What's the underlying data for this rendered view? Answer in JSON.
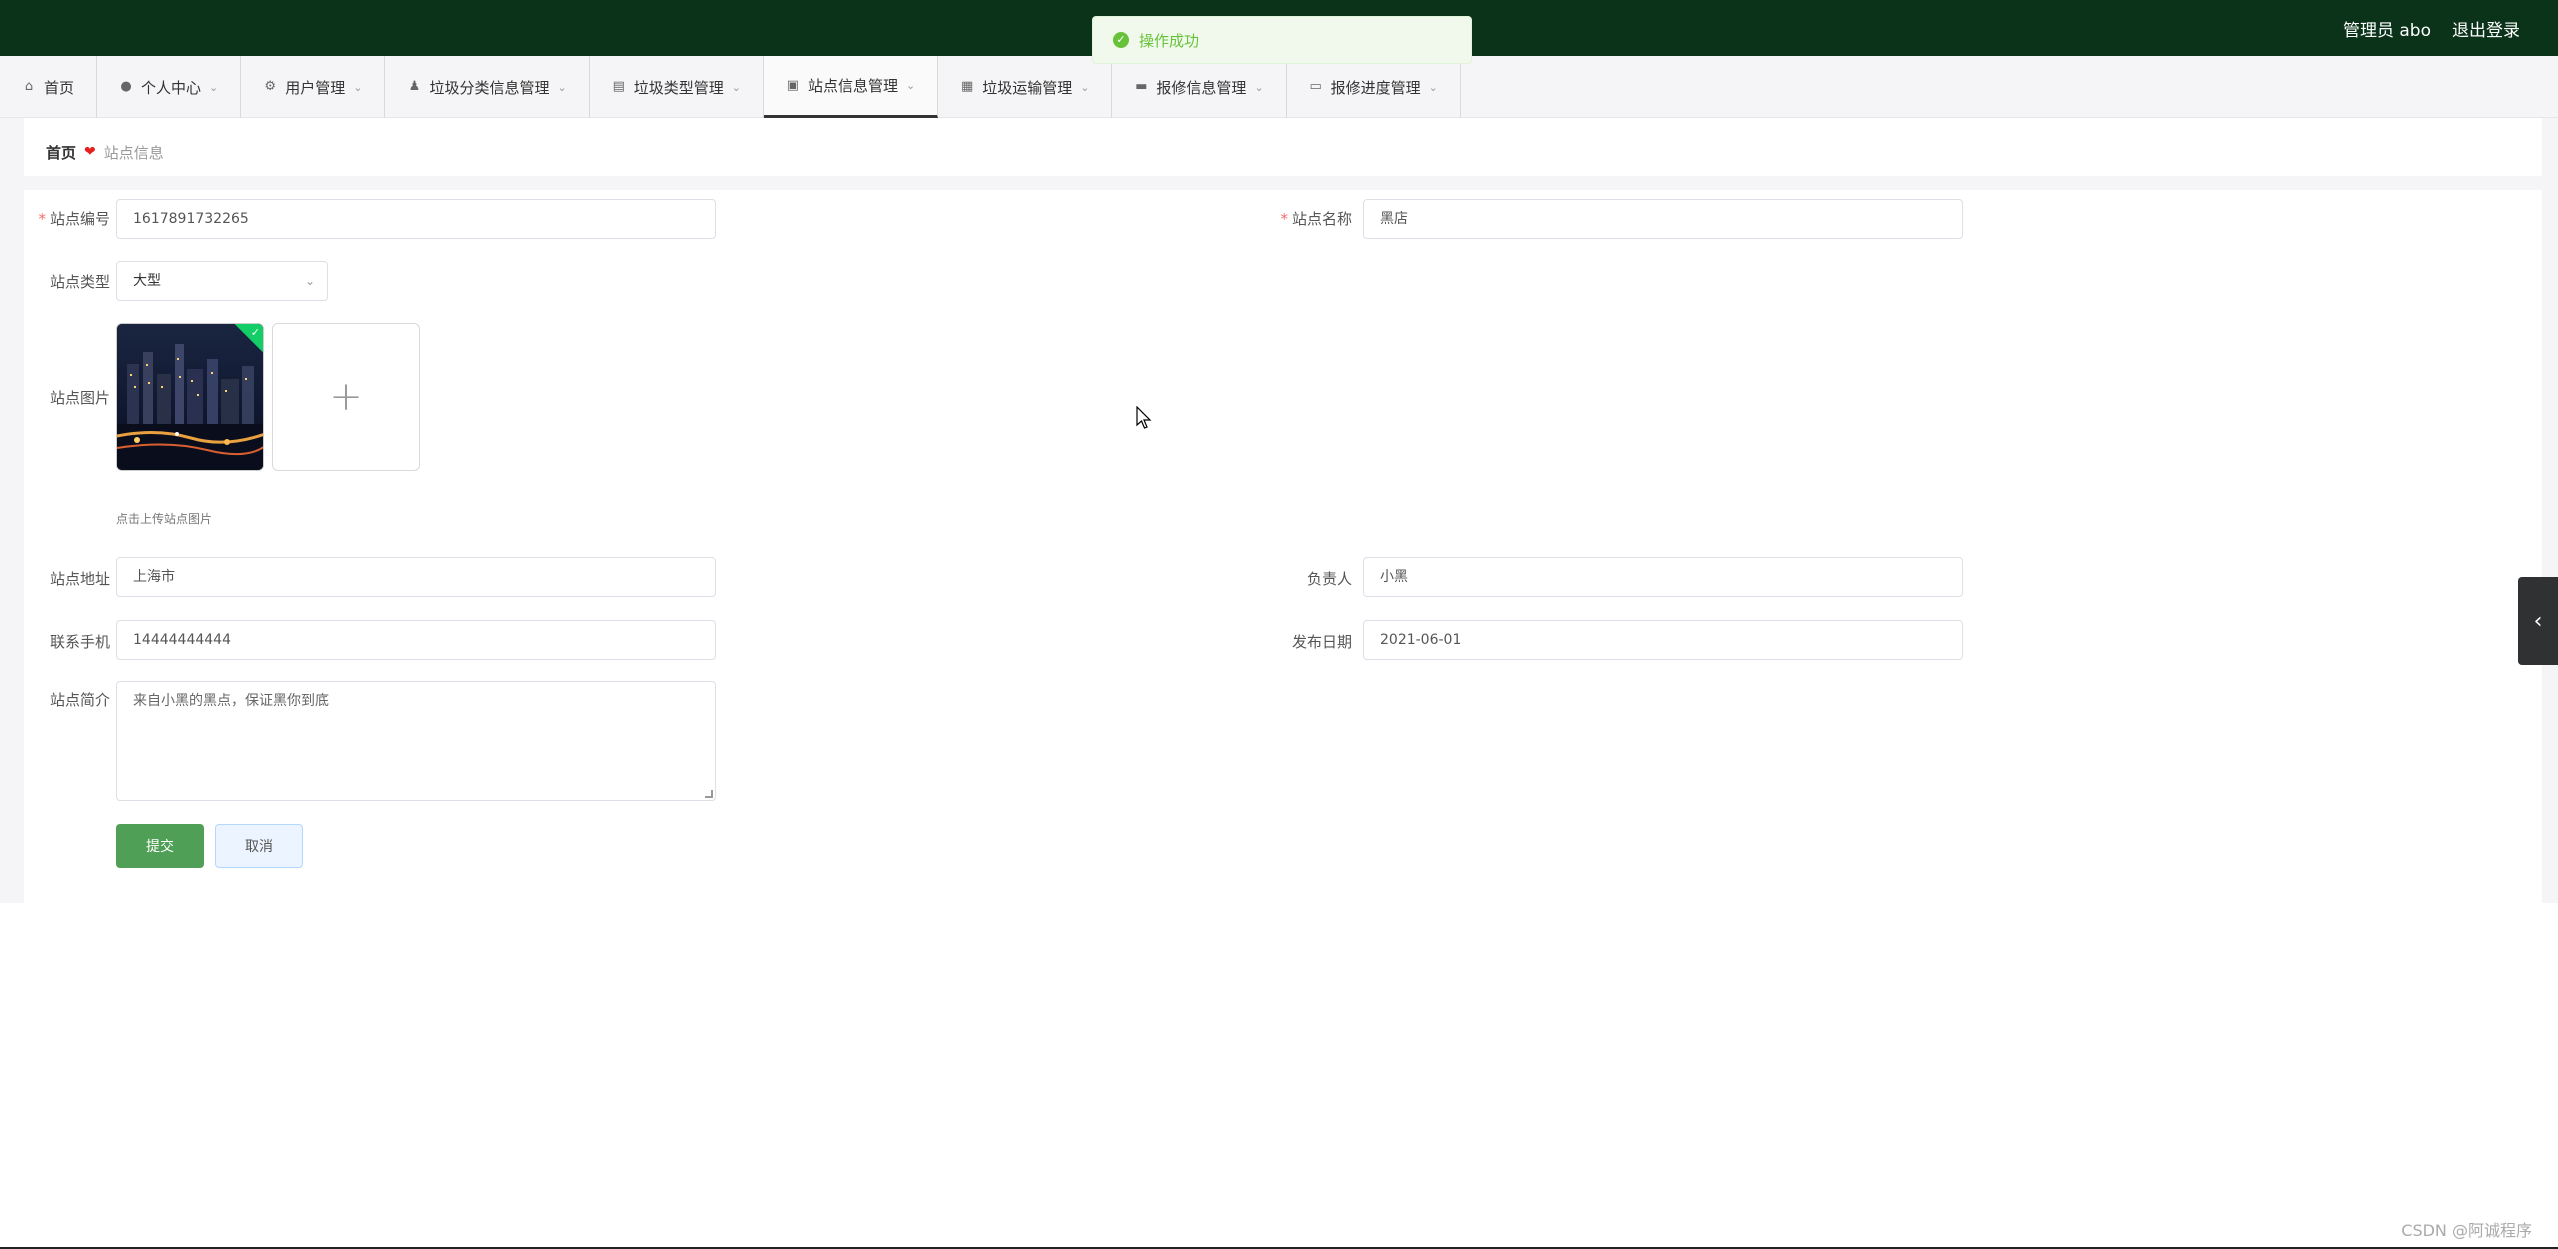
{
  "toast": {
    "message": "操作成功"
  },
  "header": {
    "user_label": "管理员 abo",
    "logout_label": "退出登录"
  },
  "nav": {
    "items": [
      {
        "label": "首页",
        "icon": "home-icon",
        "has_dropdown": false
      },
      {
        "label": "个人中心",
        "icon": "user-icon",
        "has_dropdown": true
      },
      {
        "label": "用户管理",
        "icon": "gear-icon",
        "has_dropdown": true
      },
      {
        "label": "垃圾分类信息管理",
        "icon": "person-icon",
        "has_dropdown": true
      },
      {
        "label": "垃圾类型管理",
        "icon": "chart-icon",
        "has_dropdown": true
      },
      {
        "label": "站点信息管理",
        "icon": "clipboard-icon",
        "has_dropdown": true,
        "active": true
      },
      {
        "label": "垃圾运输管理",
        "icon": "grid-icon",
        "has_dropdown": true
      },
      {
        "label": "报修信息管理",
        "icon": "monitor-icon",
        "has_dropdown": true
      },
      {
        "label": "报修进度管理",
        "icon": "card-icon",
        "has_dropdown": true
      }
    ]
  },
  "breadcrumb": {
    "home": "首页",
    "current": "站点信息"
  },
  "form": {
    "site_no": {
      "label": "站点编号",
      "value": "1617891732265"
    },
    "site_name": {
      "label": "站点名称",
      "value": "黑店"
    },
    "site_type": {
      "label": "站点类型",
      "value": "大型"
    },
    "site_image": {
      "label": "站点图片",
      "hint": "点击上传站点图片"
    },
    "address": {
      "label": "站点地址",
      "value": "上海市"
    },
    "manager": {
      "label": "负责人",
      "value": "小黑"
    },
    "phone": {
      "label": "联系手机",
      "value": "14444444444"
    },
    "publish_date": {
      "label": "发布日期",
      "value": "2021-06-01"
    },
    "intro": {
      "label": "站点简介",
      "value": "来自小黑的黑点，保证黑你到底"
    }
  },
  "buttons": {
    "submit": "提交",
    "cancel": "取消"
  },
  "watermark": "CSDN @阿诚程序",
  "colors": {
    "header_bg": "#0a3319",
    "submit_bg": "#4f9f56",
    "toast_text": "#67c23a",
    "required": "#f56c6c"
  }
}
